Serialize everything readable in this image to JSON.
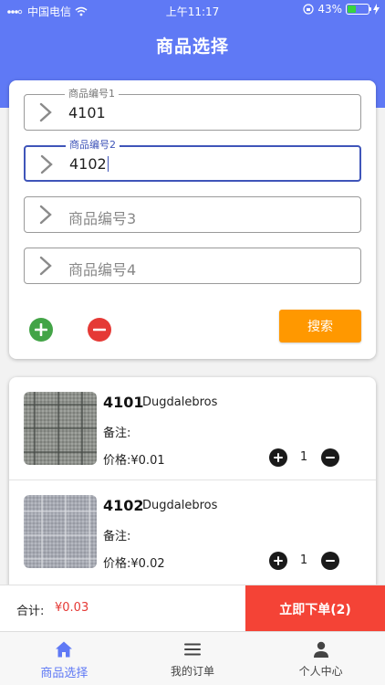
{
  "status_bar": {
    "carrier": "中国电信",
    "time": "上午11:17",
    "battery": "43%",
    "battery_level": 0.43
  },
  "header": {
    "title": "商品选择"
  },
  "search_form": {
    "fields": [
      {
        "label": "商品编号1",
        "value": "4101",
        "placeholder": "商品编号1"
      },
      {
        "label": "商品编号2",
        "value": "4102",
        "placeholder": "商品编号2"
      },
      {
        "label": "",
        "value": "",
        "placeholder": "商品编号3"
      },
      {
        "label": "",
        "value": "",
        "placeholder": "商品编号4"
      }
    ],
    "search_label": "搜索"
  },
  "results": [
    {
      "code": "4101",
      "brand": "Dugdalebros",
      "note_label": "备注:",
      "price_label": "价格:",
      "price": "¥0.01",
      "qty": "1"
    },
    {
      "code": "4102",
      "brand": "Dugdalebros",
      "note_label": "备注:",
      "price_label": "价格:",
      "price": "¥0.02",
      "qty": "1"
    }
  ],
  "cart": {
    "total_label": "合计:",
    "total_value": "¥0.03",
    "order_label": "立即下单(2)"
  },
  "tabs": [
    {
      "label": "商品选择",
      "icon": "home-icon",
      "active": true
    },
    {
      "label": "我的订单",
      "icon": "list-icon",
      "active": false
    },
    {
      "label": "个人中心",
      "icon": "person-icon",
      "active": false
    }
  ],
  "colors": {
    "primary": "#5f79f5",
    "search_button": "#ff9800",
    "order_button": "#f44336",
    "add": "#43a447",
    "remove": "#e53935",
    "price_total": "#e53935"
  }
}
